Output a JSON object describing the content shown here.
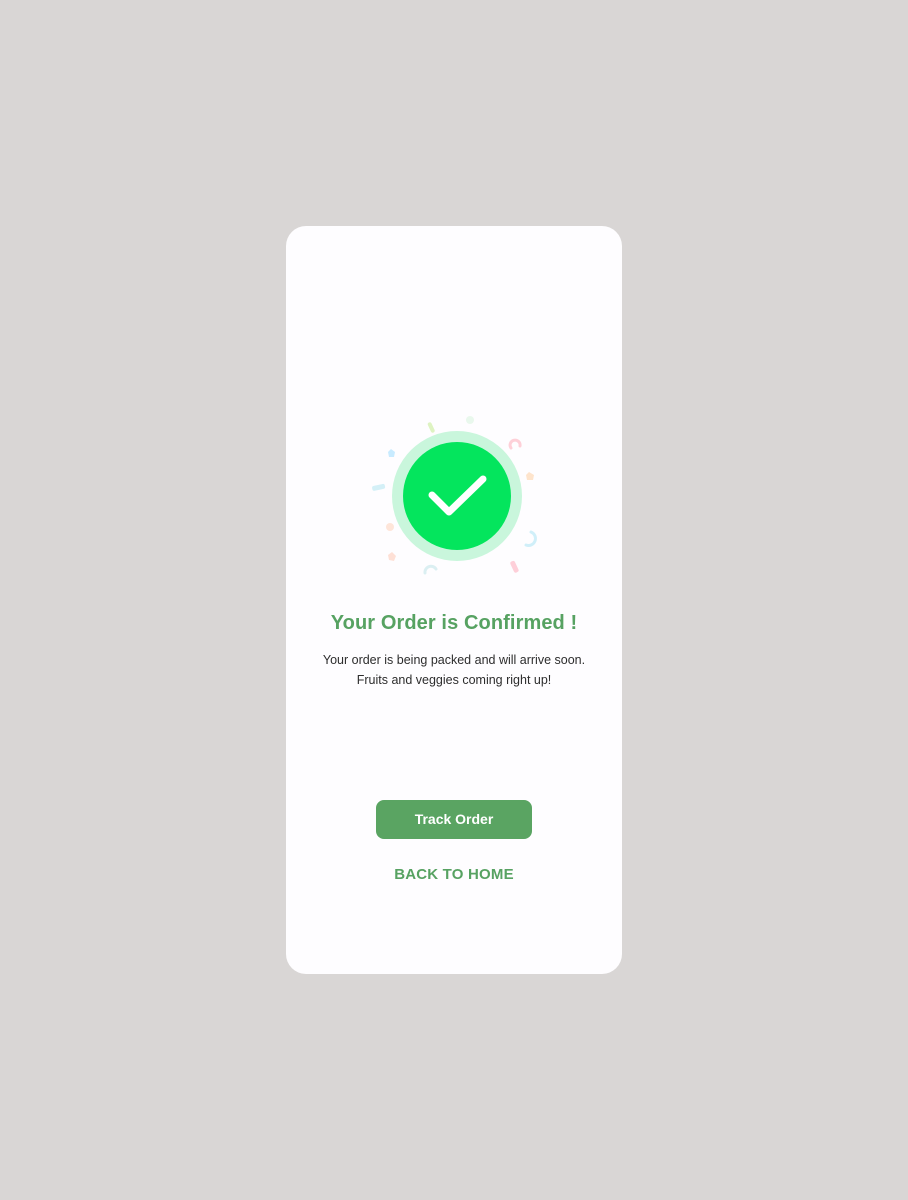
{
  "confirmation": {
    "title": "Your Order is Confirmed !",
    "message_line1": "Your order is being packed and will arrive soon.",
    "message_line2": "Fruits and veggies coming right up!"
  },
  "actions": {
    "track_order_label": "Track Order",
    "back_home_label": "BACK TO HOME"
  },
  "icons": {
    "status_icon": "check-circle-icon",
    "decoration": "confetti"
  },
  "colors": {
    "page_background": "#d9d6d5",
    "card_background": "#fefdff",
    "accent_green": "#57a262",
    "check_circle": "#04e55d",
    "check_halo": "#c9f6dc",
    "body_text": "#2d2d2d"
  }
}
